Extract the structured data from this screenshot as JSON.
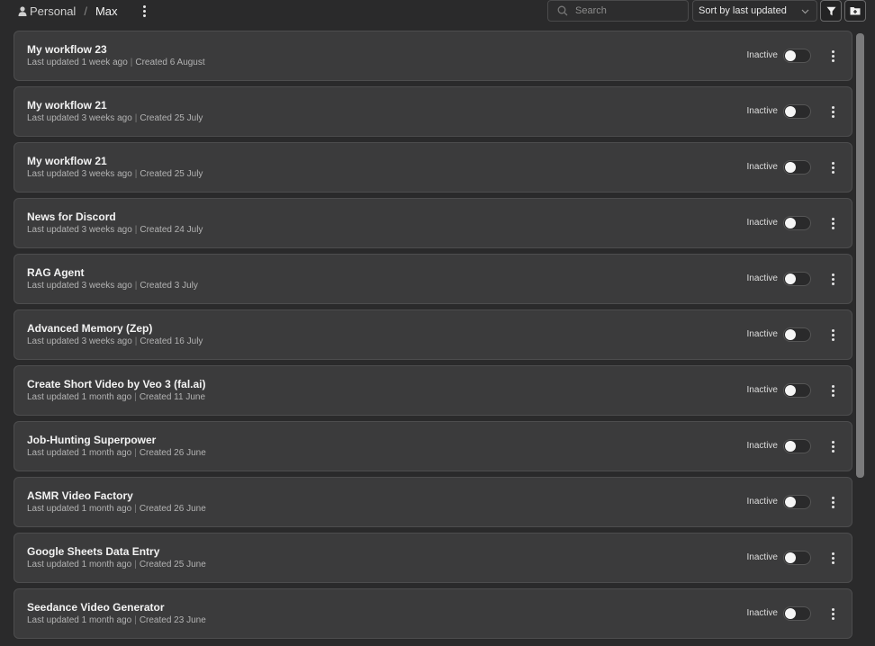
{
  "breadcrumb": {
    "personal": "Personal",
    "current": "Max",
    "separator": "/"
  },
  "search": {
    "placeholder": "Search",
    "value": ""
  },
  "sort": {
    "label": "Sort by last updated"
  },
  "icons": {
    "person": "person-icon",
    "kebab": "kebab-menu-icon",
    "search": "search-icon",
    "chevron": "chevron-down-icon",
    "filter": "filter-icon",
    "folder": "folder-add-icon"
  },
  "colors": {
    "background": "#2a2a2b",
    "card": "#3b3b3c",
    "toggle_off": "#2a2a2b",
    "knob": "#f5f5f5"
  },
  "workflows": [
    {
      "title": "My workflow 23",
      "updated": "Last updated 1 week ago",
      "created": "Created 6 August",
      "status": "Inactive",
      "active": false
    },
    {
      "title": "My workflow 21",
      "updated": "Last updated 3 weeks ago",
      "created": "Created 25 July",
      "status": "Inactive",
      "active": false
    },
    {
      "title": "My workflow 21",
      "updated": "Last updated 3 weeks ago",
      "created": "Created 25 July",
      "status": "Inactive",
      "active": false
    },
    {
      "title": "News for Discord",
      "updated": "Last updated 3 weeks ago",
      "created": "Created 24 July",
      "status": "Inactive",
      "active": false
    },
    {
      "title": "RAG Agent",
      "updated": "Last updated 3 weeks ago",
      "created": "Created 3 July",
      "status": "Inactive",
      "active": false
    },
    {
      "title": "Advanced Memory (Zep)",
      "updated": "Last updated 3 weeks ago",
      "created": "Created 16 July",
      "status": "Inactive",
      "active": false
    },
    {
      "title": "Create Short Video by Veo 3 (fal.ai)",
      "updated": "Last updated 1 month ago",
      "created": "Created 11 June",
      "status": "Inactive",
      "active": false
    },
    {
      "title": "Job-Hunting Superpower",
      "updated": "Last updated 1 month ago",
      "created": "Created 26 June",
      "status": "Inactive",
      "active": false
    },
    {
      "title": "ASMR Video Factory",
      "updated": "Last updated 1 month ago",
      "created": "Created 26 June",
      "status": "Inactive",
      "active": false
    },
    {
      "title": "Google Sheets Data Entry",
      "updated": "Last updated 1 month ago",
      "created": "Created 25 June",
      "status": "Inactive",
      "active": false
    },
    {
      "title": "Seedance Video Generator",
      "updated": "Last updated 1 month ago",
      "created": "Created 23 June",
      "status": "Inactive",
      "active": false
    }
  ]
}
